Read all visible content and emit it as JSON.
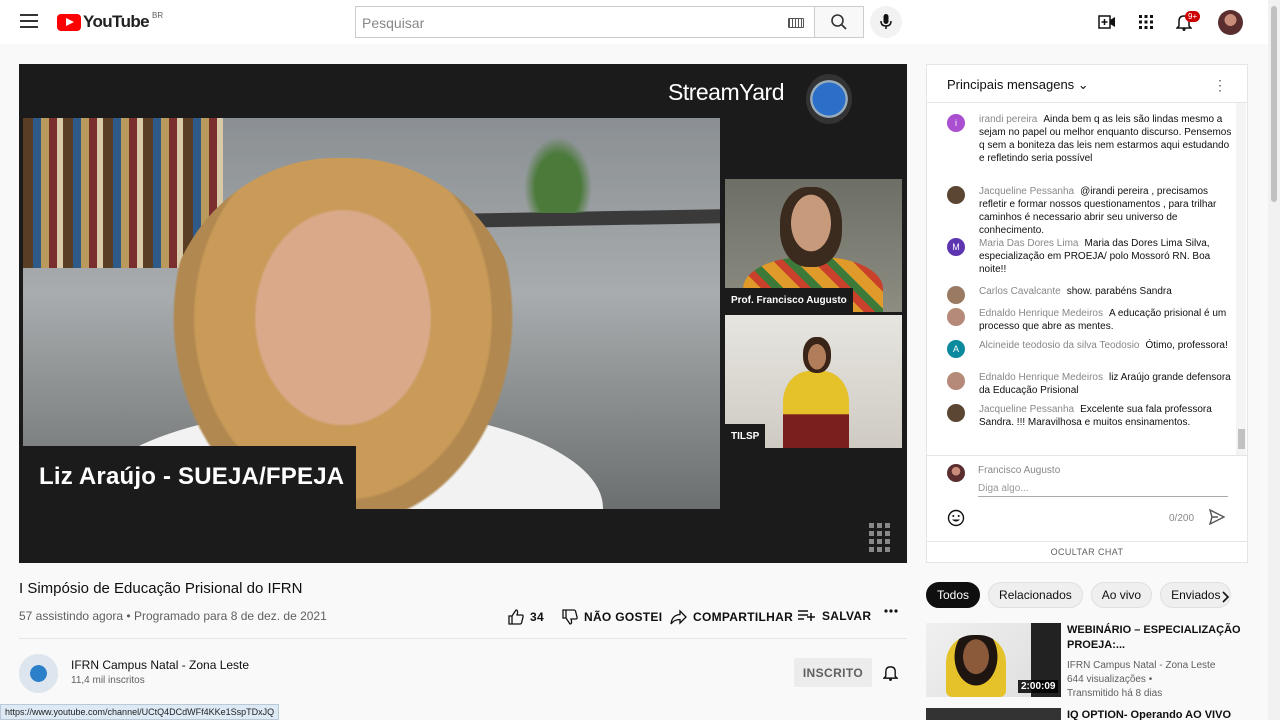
{
  "topbar": {
    "logo_text": "YouTube",
    "country_code": "BR",
    "search_placeholder": "Pesquisar",
    "notifications_badge": "9+"
  },
  "player": {
    "streamyard_brand": "StreamYard",
    "main_speaker_label": "Liz Araújo - SUEJA/FPEJA",
    "cam1_label": "Prof. Francisco Augusto",
    "cam2_label": "TILSP"
  },
  "video": {
    "title": "I Simpósio de Educação Prisional do IFRN",
    "watching": "57 assistindo agora",
    "separator": "•",
    "scheduled": "Programado para 8 de dez. de 2021",
    "like_count": "34",
    "dislike_label": "NÃO GOSTEI",
    "share_label": "COMPARTILHAR",
    "save_label": "SALVAR"
  },
  "channel": {
    "name": "IFRN Campus Natal - Zona Leste",
    "subscribers": "11,4 mil inscritos",
    "subscribe_label": "INSCRITO"
  },
  "status_url": "https://www.youtube.com/channel/UCtQ4DCdWFf4KKe1SspTDxJQ",
  "chat": {
    "header": "Principais mensagens",
    "messages": [
      {
        "avatar_letter": "i",
        "avatar_color": "#a94fd0",
        "author": "irandi pereira",
        "text": "Ainda bem q as leis são lindas mesmo a sejam no papel ou melhor enquanto discurso. Pensemos q sem a boniteza das leis nem estarmos aqui estudando e refletindo seria possível"
      },
      {
        "avatar_letter": "",
        "avatar_color": "#5a4632",
        "author": "Jacqueline Pessanha",
        "text": "@irandi pereira , precisamos refletir e formar nossos questionamentos , para trilhar caminhos é necessario abrir seu universo de conhecimento."
      },
      {
        "avatar_letter": "M",
        "avatar_color": "#5e35b1",
        "author": "Maria Das Dores Lima",
        "text": "Maria das Dores Lima Silva, especialização em PROEJA/ polo Mossoró RN. Boa noite!!"
      },
      {
        "avatar_letter": "",
        "avatar_color": "#9a7a62",
        "author": "Carlos Cavalcante",
        "text": "show. parabéns Sandra"
      },
      {
        "avatar_letter": "",
        "avatar_color": "#b58a78",
        "author": "Ednaldo Henrique Medeiros",
        "text": "A educação prisional é um processo que abre as mentes."
      },
      {
        "avatar_letter": "A",
        "avatar_color": "#0b8a9e",
        "author": "Alcineide teodosio da silva Teodosio",
        "text": "Ótimo, professora!"
      },
      {
        "avatar_letter": "",
        "avatar_color": "#b58a78",
        "author": "Ednaldo Henrique Medeiros",
        "text": "liz Araújo grande defensora da Educação Prisional"
      },
      {
        "avatar_letter": "",
        "avatar_color": "#5a4632",
        "author": "Jacqueline Pessanha",
        "text": "Excelente sua fala professora Sandra. !!! Maravilhosa e muitos ensinamentos."
      }
    ],
    "input_author": "Francisco Augusto",
    "input_placeholder": "Diga algo...",
    "char_count": "0/200",
    "hide_label": "OCULTAR CHAT"
  },
  "chips": [
    "Todos",
    "Relacionados",
    "Ao vivo",
    "Enviados"
  ],
  "related": [
    {
      "title": "WEBINÁRIO – ESPECIALIZAÇÃO PROEJA:...",
      "channel": "IFRN Campus Natal - Zona Leste",
      "views": "644 visualizações •",
      "age": "Transmitido há 8 dias",
      "duration": "2:00:09"
    },
    {
      "title": "IQ OPTION- Operando AO VIVO"
    }
  ]
}
